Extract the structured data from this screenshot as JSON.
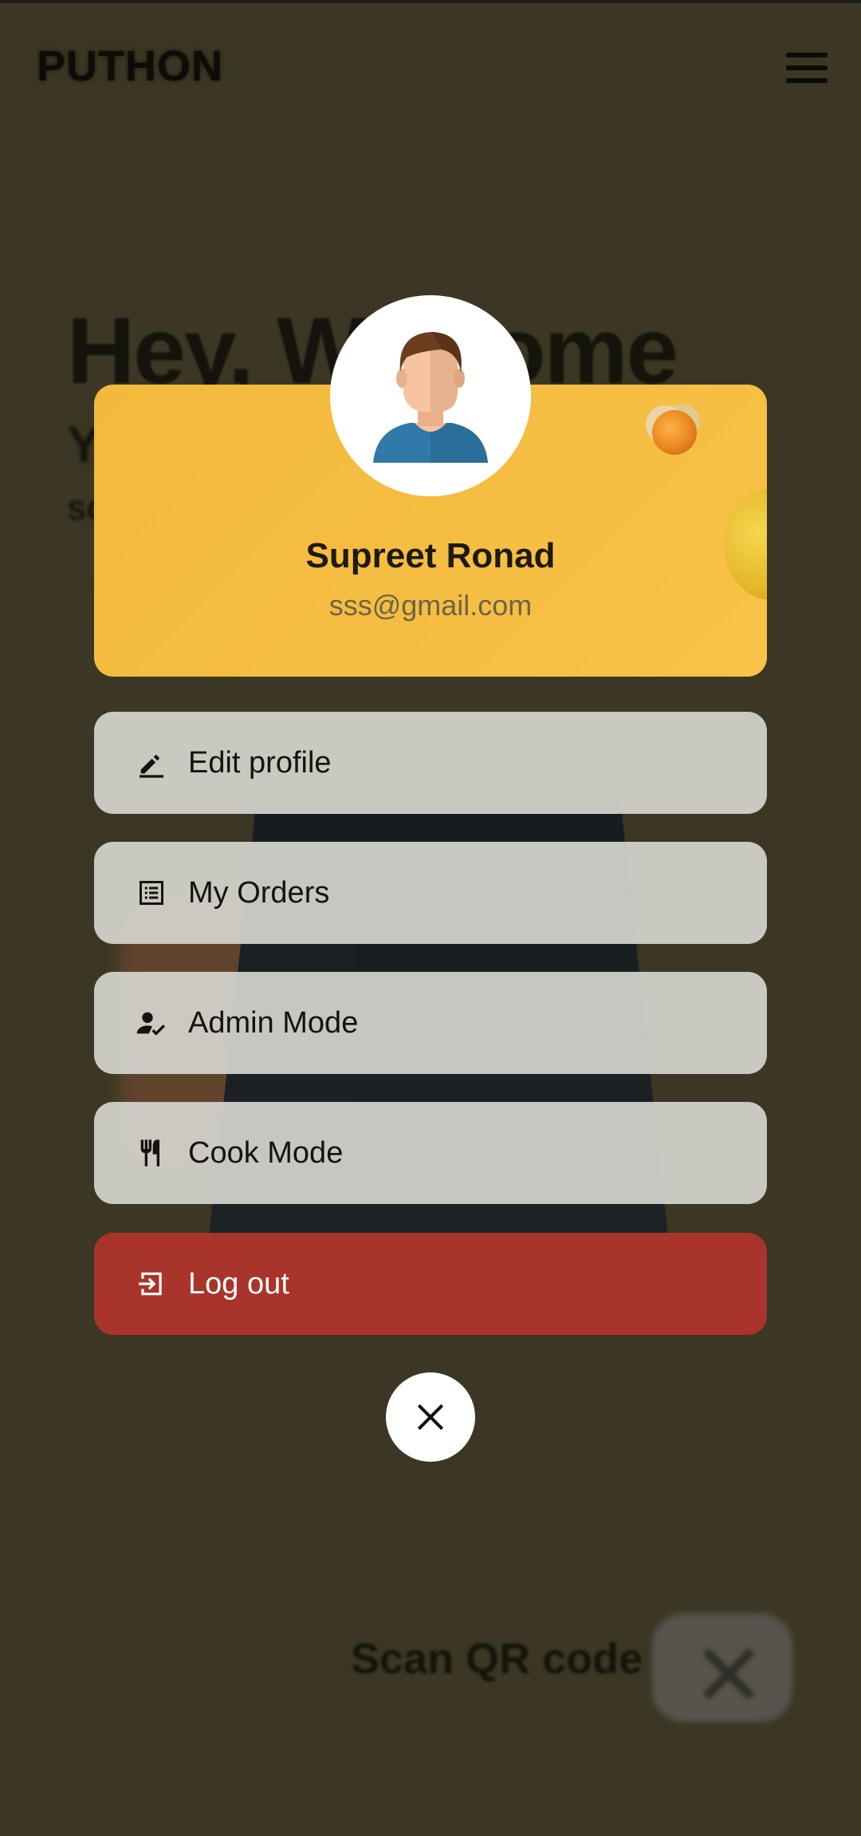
{
  "app": {
    "brand": "PUTHON"
  },
  "background": {
    "welcome_title": "Hey, Welcome",
    "line2": "Y",
    "line3": "sc",
    "scan_label": "Scan QR code"
  },
  "profile": {
    "name": "Supreet Ronad",
    "email": "sss@gmail.com",
    "avatar_icon": "user-avatar-icon"
  },
  "menu": [
    {
      "label": "Edit profile",
      "icon": "edit-pencil-icon"
    },
    {
      "label": "My Orders",
      "icon": "orders-list-icon"
    },
    {
      "label": "Admin Mode",
      "icon": "admin-user-check-icon"
    },
    {
      "label": "Cook Mode",
      "icon": "fork-knife-icon"
    },
    {
      "label": "Log out",
      "icon": "logout-icon"
    }
  ],
  "colors": {
    "card_yellow": "#f5bd41",
    "logout_red": "#a8342b",
    "menu_gray": "#d4d4ce"
  }
}
